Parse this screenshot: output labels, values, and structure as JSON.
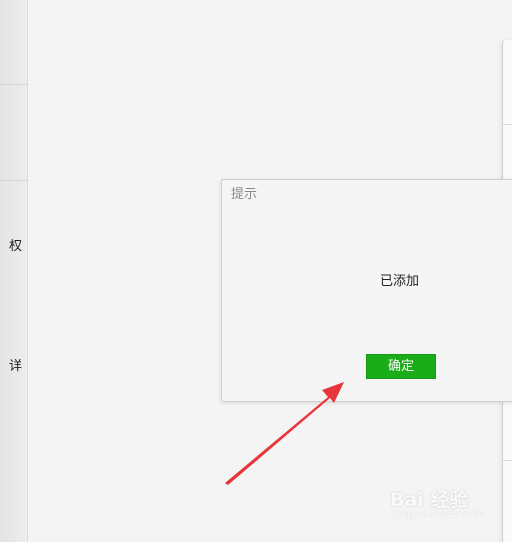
{
  "sidebar": {
    "fragments": [
      "权",
      "详"
    ]
  },
  "dialog": {
    "title": "提示",
    "message": "已添加",
    "confirm_label": "确定",
    "accent_color": "#1aad19"
  },
  "annotation": {
    "color": "#e8353b"
  },
  "watermark": {
    "text": "Bai 经验",
    "sub": "jingyan.baidu.com"
  }
}
